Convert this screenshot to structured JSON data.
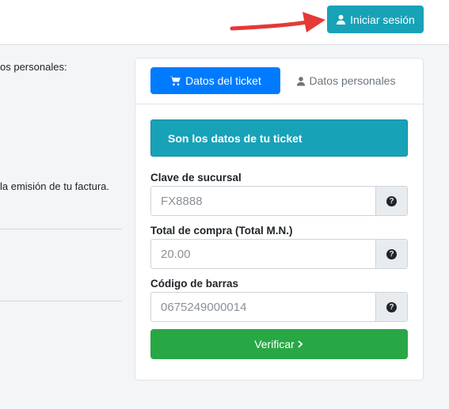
{
  "header": {
    "login_label": "Iniciar sesión"
  },
  "left_panel": {
    "text_1": "os personales:",
    "text_2": "la emisión de tu factura."
  },
  "card": {
    "tabs": [
      {
        "label": "Datos del ticket",
        "icon": "cart-icon",
        "active": true
      },
      {
        "label": "Datos personales",
        "icon": "user-icon",
        "active": false
      }
    ],
    "alert_text": "Son los datos de tu ticket",
    "fields": [
      {
        "label": "Clave de sucursal",
        "placeholder": "FX8888"
      },
      {
        "label": "Total de compra (Total M.N.)",
        "placeholder": "20.00"
      },
      {
        "label": "Código de barras",
        "placeholder": "0675249000014"
      }
    ],
    "verify_label": "Verificar"
  },
  "colors": {
    "login_button": "#17a2b8",
    "active_tab": "#007bff",
    "alert": "#17a2b8",
    "verify_button": "#28a745",
    "arrow": "#e53935"
  }
}
